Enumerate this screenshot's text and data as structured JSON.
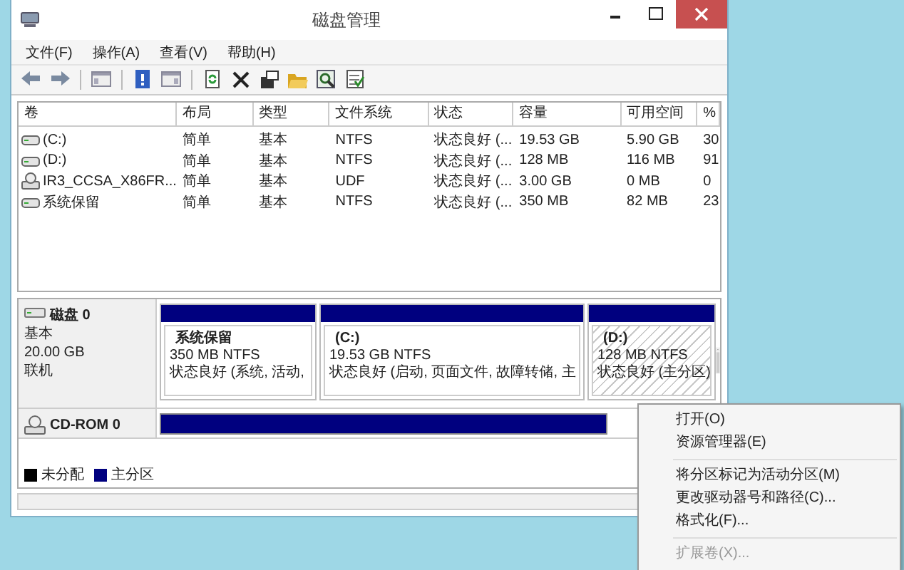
{
  "window": {
    "title": "磁盘管理"
  },
  "menu": [
    "文件(F)",
    "操作(A)",
    "查看(V)",
    "帮助(H)"
  ],
  "volume_list": {
    "columns": [
      "卷",
      "布局",
      "类型",
      "文件系统",
      "状态",
      "容量",
      "可用空间",
      "%"
    ],
    "rows": [
      {
        "kind": "drive",
        "cells": [
          "(C:)",
          "简单",
          "基本",
          "NTFS",
          "状态良好 (...",
          "19.53 GB",
          "5.90 GB",
          "30"
        ]
      },
      {
        "kind": "drive",
        "cells": [
          "(D:)",
          "简单",
          "基本",
          "NTFS",
          "状态良好 (...",
          "128 MB",
          "116 MB",
          "91"
        ]
      },
      {
        "kind": "cdrom",
        "cells": [
          "IR3_CCSA_X86FR...",
          "简单",
          "基本",
          "UDF",
          "状态良好 (...",
          "3.00 GB",
          "0 MB",
          "0"
        ]
      },
      {
        "kind": "drive",
        "cells": [
          "系统保留",
          "简单",
          "基本",
          "NTFS",
          "状态良好 (...",
          "350 MB",
          "82 MB",
          "23"
        ]
      }
    ]
  },
  "disks": [
    {
      "kind": "disk",
      "name": "磁盘 0",
      "lines": [
        "基本",
        "20.00 GB",
        "联机"
      ],
      "partitions": [
        {
          "name": "系统保留",
          "size": "350 MB NTFS",
          "status": "状态良好 (系统, 活动,",
          "selected": false
        },
        {
          "name": "(C:)",
          "size": "19.53 GB NTFS",
          "status": "状态良好 (启动, 页面文件, 故障转储, 主",
          "selected": false
        },
        {
          "name": "(D:)",
          "size": "128 MB NTFS",
          "status": "状态良好 (主分区)",
          "selected": true
        }
      ]
    },
    {
      "kind": "cdrom",
      "name": "CD-ROM 0"
    }
  ],
  "legend": [
    {
      "label": "未分配",
      "color": "#000000"
    },
    {
      "label": "主分区",
      "color": "#00007f"
    }
  ],
  "context_menu": [
    {
      "kind": "item",
      "label": "打开(O)",
      "disabled": false
    },
    {
      "kind": "item",
      "label": "资源管理器(E)",
      "disabled": false
    },
    {
      "kind": "separator"
    },
    {
      "kind": "item",
      "label": "将分区标记为活动分区(M)",
      "disabled": false
    },
    {
      "kind": "item",
      "label": "更改驱动器号和路径(C)...",
      "disabled": false
    },
    {
      "kind": "item",
      "label": "格式化(F)...",
      "disabled": false
    },
    {
      "kind": "separator"
    },
    {
      "kind": "item",
      "label": "扩展卷(X)...",
      "disabled": true
    }
  ]
}
